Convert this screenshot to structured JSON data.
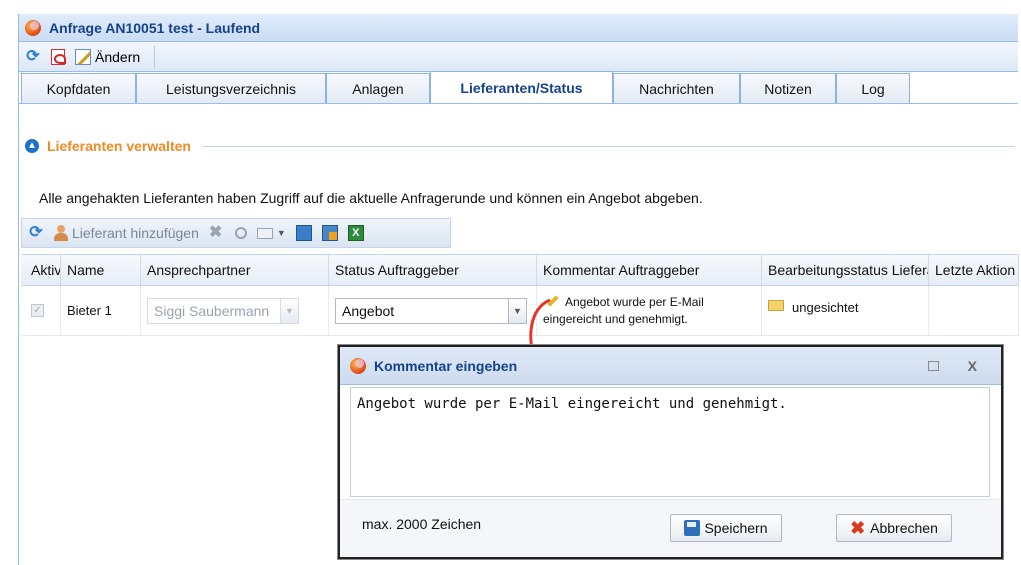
{
  "window": {
    "title": "Anfrage AN10051 test - Laufend"
  },
  "toolbar": {
    "edit_label": "Ändern"
  },
  "tabs": [
    {
      "label": "Kopfdaten",
      "active": false
    },
    {
      "label": "Leistungsverzeichnis",
      "active": false
    },
    {
      "label": "Anlagen",
      "active": false
    },
    {
      "label": "Lieferanten/Status",
      "active": true
    },
    {
      "label": "Nachrichten",
      "active": false
    },
    {
      "label": "Notizen",
      "active": false
    },
    {
      "label": "Log",
      "active": false
    }
  ],
  "section": {
    "title": "Lieferanten verwalten",
    "info": "Alle angehakten Lieferanten haben Zugriff auf die aktuelle Anfragerunde und können ein Angebot abgeben."
  },
  "grid_toolbar": {
    "add_supplier_label": "Lieferant hinzufügen"
  },
  "grid": {
    "columns": [
      "Aktiv",
      "Name",
      "Ansprechpartner",
      "Status Auftraggeber",
      "Kommentar Auftraggeber",
      "Bearbeitungsstatus Lieferant",
      "Letzte Aktion"
    ],
    "rows": [
      {
        "active": true,
        "name": "Bieter 1",
        "contact": "Siggi Saubermann",
        "status": "Angebot",
        "comment_line1": "Angebot wurde per E-Mail",
        "comment_line2": "eingereicht und genehmigt.",
        "processing_status": "ungesichtet",
        "last_action": ""
      }
    ]
  },
  "dialog": {
    "title": "Kommentar eingeben",
    "text": "Angebot wurde per E-Mail eingereicht und genehmigt.",
    "max_chars": "max. 2000 Zeichen",
    "save_label": "Speichern",
    "cancel_label": "Abbrechen",
    "close_glyph": "X"
  }
}
